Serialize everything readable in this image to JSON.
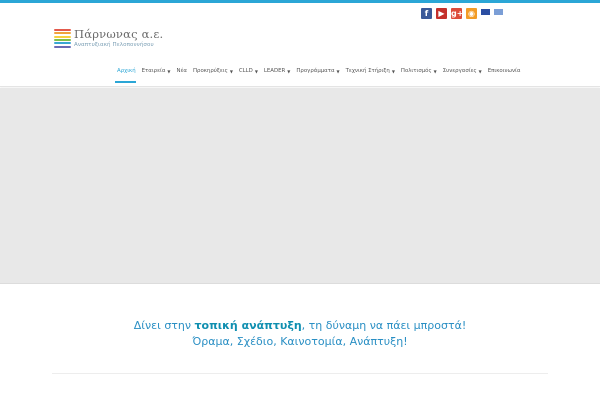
{
  "site": {
    "logo_title": "Πάρνωνας α.ε.",
    "logo_subtitle": "Αναπτυξιακή Πελοποννήσου",
    "logo_stripe_colors": [
      "#e35a4c",
      "#f0a33c",
      "#f6d13f",
      "#7fbf4a",
      "#3aa7d4",
      "#6b6bb5"
    ]
  },
  "social": [
    {
      "name": "facebook-icon",
      "glyph": "f",
      "color": "#3b5998"
    },
    {
      "name": "youtube-icon",
      "glyph": "▶",
      "color": "#c4302b"
    },
    {
      "name": "google-plus-icon",
      "glyph": "g+",
      "color": "#dd4b39"
    },
    {
      "name": "rss-icon",
      "glyph": "◉",
      "color": "#f39c26"
    }
  ],
  "languages": [
    {
      "name": "flag-english-icon"
    },
    {
      "name": "flag-greek-icon"
    }
  ],
  "nav": {
    "items": [
      {
        "label": "Αρχική",
        "active": true,
        "dropdown": false
      },
      {
        "label": "Εταιρεία",
        "active": false,
        "dropdown": true
      },
      {
        "label": "Νέα",
        "active": false,
        "dropdown": false
      },
      {
        "label": "Προκηρύξεις",
        "active": false,
        "dropdown": true
      },
      {
        "label": "CLLD",
        "active": false,
        "dropdown": true
      },
      {
        "label": "LEADER",
        "active": false,
        "dropdown": true
      },
      {
        "label": "Προγράμματα",
        "active": false,
        "dropdown": true
      },
      {
        "label": "Τεχνική Στήριξη",
        "active": false,
        "dropdown": true
      },
      {
        "label": "Πολιτισμός",
        "active": false,
        "dropdown": true
      },
      {
        "label": "Συνεργασίες",
        "active": false,
        "dropdown": true
      },
      {
        "label": "Επικοινωνία",
        "active": false,
        "dropdown": false
      }
    ]
  },
  "tagline": {
    "before": "Δίνει στην ",
    "highlight": "τοπική ανάπτυξη",
    "after": ", τη δύναμη να πάει μπροστά!",
    "line2": "Όραμα, Σχέδιο, Καινοτομία, Ανάπτυξη!"
  },
  "colors": {
    "accent": "#2ba6d6",
    "hero_bg": "#e8e8e8"
  }
}
